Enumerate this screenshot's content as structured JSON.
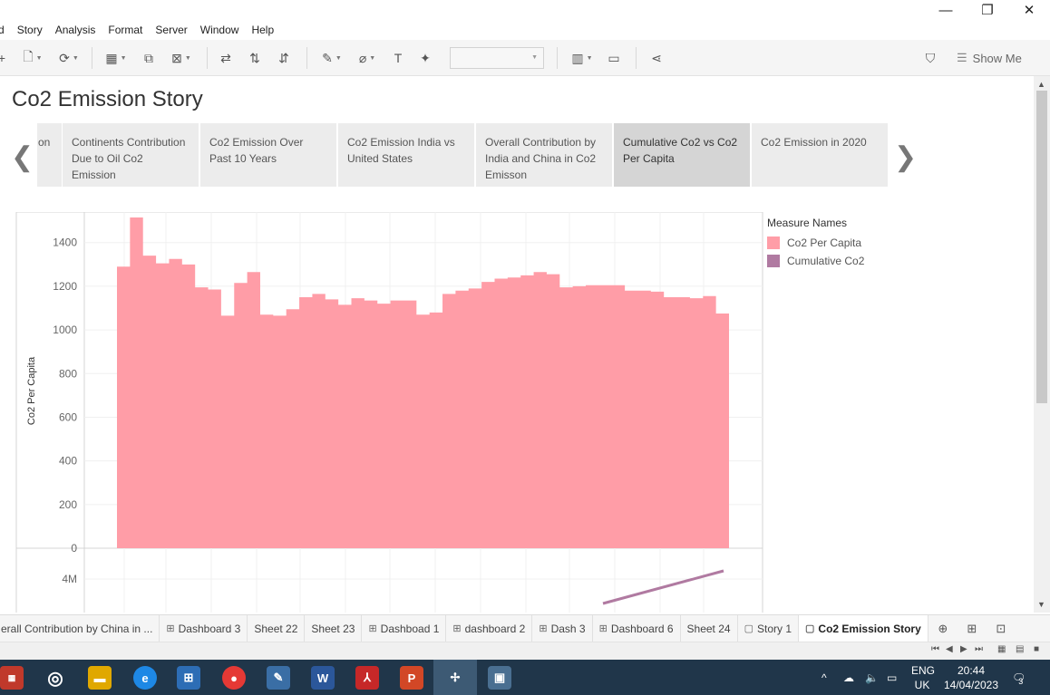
{
  "window": {
    "minimize": "—",
    "maximize": "❐",
    "close": "✕"
  },
  "menu": [
    "d",
    "Story",
    "Analysis",
    "Format",
    "Server",
    "Window",
    "Help"
  ],
  "toolbar": {
    "show_me": "Show Me"
  },
  "story": {
    "title": "Co2 Emission Story",
    "points": [
      {
        "label": "on",
        "active": false
      },
      {
        "label": "Continents Contribution Due to Oil Co2 Emission",
        "active": false
      },
      {
        "label": "Co2 Emission Over Past 10 Years",
        "active": false
      },
      {
        "label": "Co2 Emission India vs United States",
        "active": false
      },
      {
        "label": "Overall Contribution by India and China in Co2 Emisson",
        "active": false
      },
      {
        "label": "Cumulative Co2 vs Co2 Per Capita",
        "active": true
      },
      {
        "label": "Co2 Emission in 2020",
        "active": false
      }
    ]
  },
  "legend": {
    "title": "Measure Names",
    "items": [
      {
        "label": "Co2 Per Capita",
        "color": "#ff9da7"
      },
      {
        "label": "Cumulative Co2",
        "color": "#b07aa1"
      }
    ]
  },
  "chart_data": {
    "type": "area",
    "ylabel": "Co2 Per Capita",
    "ylim": [
      0,
      1540
    ],
    "yticks": [
      "0",
      "200",
      "400",
      "600",
      "800",
      "1000",
      "1200",
      "1400"
    ],
    "series": [
      {
        "name": "Co2 Per Capita",
        "color": "#ff9da7",
        "values": [
          1290,
          1515,
          1340,
          1305,
          1325,
          1300,
          1195,
          1185,
          1065,
          1215,
          1265,
          1070,
          1065,
          1095,
          1150,
          1165,
          1140,
          1115,
          1145,
          1135,
          1120,
          1135,
          1135,
          1070,
          1080,
          1165,
          1180,
          1190,
          1220,
          1235,
          1240,
          1250,
          1265,
          1255,
          1195,
          1200,
          1205,
          1205,
          1205,
          1180,
          1180,
          1175,
          1150,
          1150,
          1145,
          1155,
          1075
        ]
      },
      {
        "name": "Cumulative Co2",
        "color": "#b07aa1",
        "lower_axis_tick": "4M",
        "values_visible": [
          3100000,
          4300000
        ]
      }
    ]
  },
  "tabs": [
    {
      "label": "erall Contribution by China in ...",
      "icon": "",
      "active": false
    },
    {
      "label": "Dashboard 3",
      "icon": "⊞",
      "active": false
    },
    {
      "label": "Sheet 22",
      "icon": "",
      "active": false
    },
    {
      "label": "Sheet 23",
      "icon": "",
      "active": false
    },
    {
      "label": "Dashboad 1",
      "icon": "⊞",
      "active": false
    },
    {
      "label": "dashboard 2",
      "icon": "⊞",
      "active": false
    },
    {
      "label": "Dash 3",
      "icon": "⊞",
      "active": false
    },
    {
      "label": "Dashboard 6",
      "icon": "⊞",
      "active": false
    },
    {
      "label": "Sheet 24",
      "icon": "",
      "active": false
    },
    {
      "label": "Story 1",
      "icon": "▢",
      "active": false
    },
    {
      "label": "Co2 Emission Story",
      "icon": "▢",
      "active": true
    }
  ],
  "taskbar": {
    "lang_top": "ENG",
    "lang_bottom": "UK",
    "time": "20:44",
    "date": "14/04/2023",
    "notifications": "3"
  }
}
